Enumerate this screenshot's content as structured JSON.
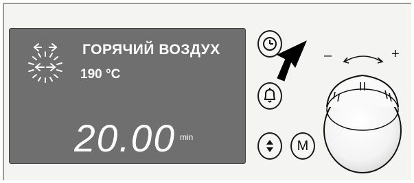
{
  "display": {
    "mode_name": "ГОРЯЧИЙ ВОЗДУХ",
    "temperature": "190 °C",
    "time_value": "20.00",
    "time_unit": "min"
  },
  "controls": {
    "menu_button_label": "M",
    "dial_minus": "–",
    "dial_plus": "+"
  },
  "icons": {
    "mode_icon": "hot-air-fan-icon",
    "clock_icon": "clock-icon",
    "bell_icon": "bell-icon",
    "updown_icon": "up-down-arrows-icon",
    "pointer": "pointer-arrow-icon",
    "dial_range": "curved-double-arrow-icon"
  },
  "colors": {
    "display_bg": "#6f6f6f",
    "display_text": "#ffffff",
    "panel_bg": "#f4f4f2"
  }
}
